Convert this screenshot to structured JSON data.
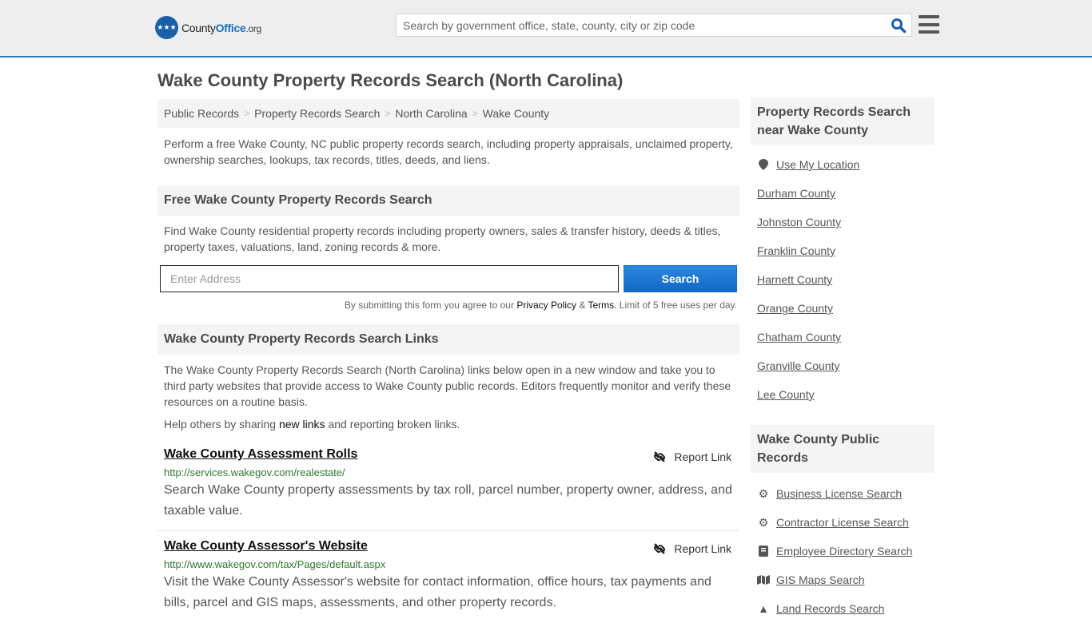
{
  "header": {
    "logo_brand": "County",
    "logo_brand_bold": "Office",
    "logo_tld": ".org",
    "search_placeholder": "Search by government office, state, county, city or zip code"
  },
  "page_title": "Wake County Property Records Search (North Carolina)",
  "breadcrumb": [
    "Public Records",
    "Property Records Search",
    "North Carolina",
    "Wake County"
  ],
  "intro": "Perform a free Wake County, NC public property records search, including property appraisals, unclaimed property, ownership searches, lookups, tax records, titles, deeds, and liens.",
  "free_search": {
    "heading": "Free Wake County Property Records Search",
    "description": "Find Wake County residential property records including property owners, sales & transfer history, deeds & titles, property taxes, valuations, land, zoning records & more.",
    "address_placeholder": "Enter Address",
    "button_label": "Search",
    "disclaimer_prefix": "By submitting this form you agree to our ",
    "privacy_label": "Privacy Policy",
    "amp": " & ",
    "terms_label": "Terms",
    "disclaimer_suffix": ". Limit of 5 free uses per day."
  },
  "links_section": {
    "heading": "Wake County Property Records Search Links",
    "description": "The Wake County Property Records Search (North Carolina) links below open in a new window and take you to third party websites that provide access to Wake County public records. Editors frequently monitor and verify these resources on a routine basis.",
    "help_prefix": "Help others by sharing ",
    "help_link": "new links",
    "help_suffix": " and reporting broken links.",
    "report_label": "Report Link",
    "items": [
      {
        "title": "Wake County Assessment Rolls",
        "url": "http://services.wakegov.com/realestate/",
        "description": "Search Wake County property assessments by tax roll, parcel number, property owner, address, and taxable value."
      },
      {
        "title": "Wake County Assessor's Website",
        "url": "http://www.wakegov.com/tax/Pages/default.aspx",
        "description": "Visit the Wake County Assessor's website for contact information, office hours, tax payments and bills, parcel and GIS maps, assessments, and other property records."
      }
    ]
  },
  "sidebar": {
    "nearby_heading": "Property Records Search near Wake County",
    "use_location": "Use My Location",
    "nearby": [
      "Durham County",
      "Johnston County",
      "Franklin County",
      "Harnett County",
      "Orange County",
      "Chatham County",
      "Granville County",
      "Lee County"
    ],
    "public_heading": "Wake County Public Records",
    "public_records": [
      {
        "label": "Business License Search",
        "icon": "gears-icon"
      },
      {
        "label": "Contractor License Search",
        "icon": "gear-icon"
      },
      {
        "label": "Employee Directory Search",
        "icon": "book-icon"
      },
      {
        "label": "GIS Maps Search",
        "icon": "map-icon"
      },
      {
        "label": "Land Records Search",
        "icon": "tree-icon"
      }
    ]
  }
}
